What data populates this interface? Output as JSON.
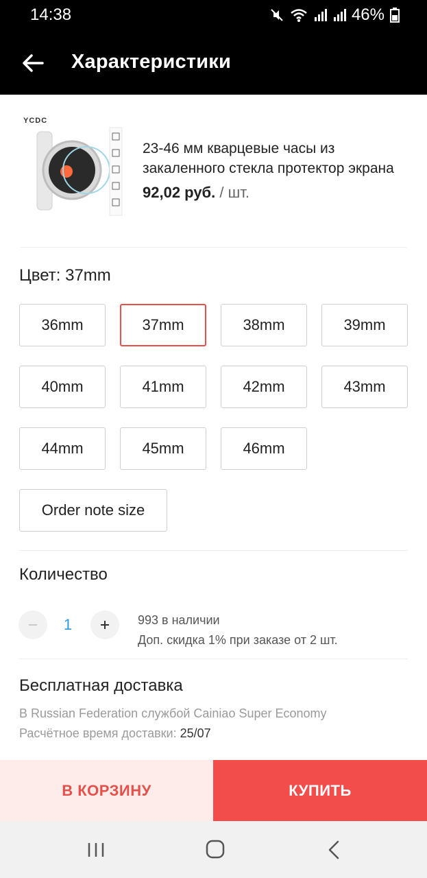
{
  "status_bar": {
    "time": "14:38",
    "battery": "46%",
    "icons": [
      "mute-icon",
      "wifi-icon",
      "signal-icon",
      "signal-icon",
      "battery-icon"
    ]
  },
  "app_bar": {
    "title": "Характеристики",
    "back_icon": "arrow-left-icon"
  },
  "product": {
    "brand": "YCDC",
    "title": "23-46 мм кварцевые часы из закаленного стекла протектор экрана",
    "price": "92,02 руб.",
    "unit": "/ шт."
  },
  "color": {
    "label": "Цвет: 37mm",
    "selected_index": 1,
    "options": [
      "36mm",
      "37mm",
      "38mm",
      "39mm",
      "40mm",
      "41mm",
      "42mm",
      "43mm",
      "44mm",
      "45mm",
      "46mm"
    ],
    "note_option": "Order note size",
    "accent": "#e5504a"
  },
  "quantity": {
    "label": "Количество",
    "value": "1",
    "stock": "993 в наличии",
    "discount": "Доп. скидка 1% при заказе от 2 шт."
  },
  "shipping": {
    "title": "Бесплатная доставка",
    "line1": "В Russian Federation службой Cainiao Super Economy",
    "line2_prefix": "Расчётное время доставки: ",
    "date": "25/07"
  },
  "actions": {
    "cart": "В КОРЗИНУ",
    "buy": "КУПИТЬ",
    "cart_bg": "#fdecea",
    "buy_bg": "#f24d4b"
  },
  "nav": {
    "icons": [
      "recent-apps-icon",
      "home-icon",
      "back-icon"
    ]
  }
}
